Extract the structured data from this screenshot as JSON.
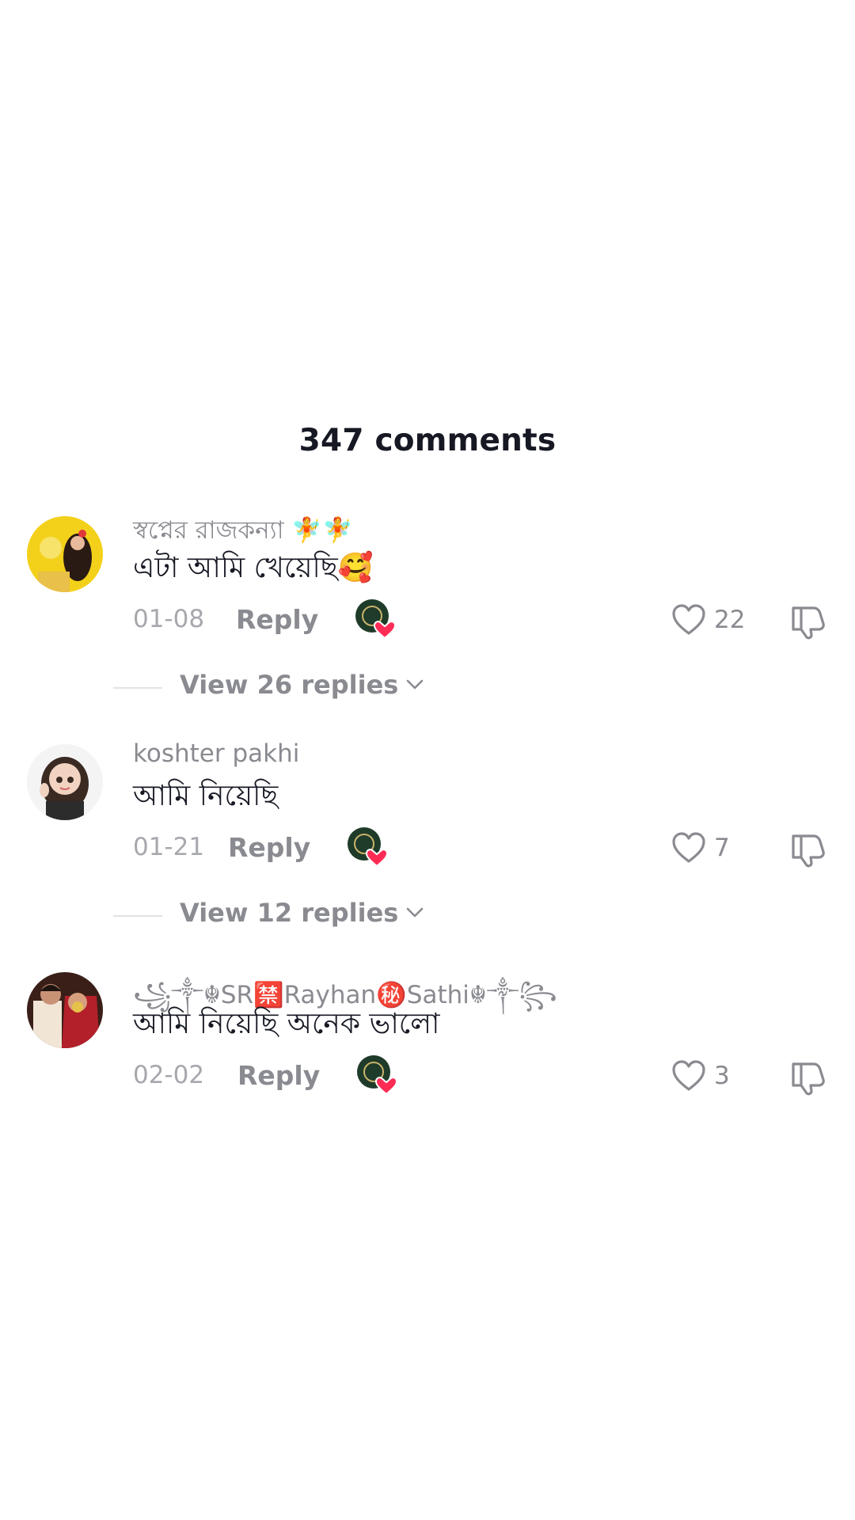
{
  "header": {
    "title": "347 comments"
  },
  "comments": [
    {
      "username": "স্বপ্নের রাজকন্যা 🧚🧚",
      "text": "এটা আমি খেয়েছি🥰",
      "date": "01-08",
      "reply_label": "Reply",
      "likes": "22",
      "replies_label": "View 26 replies"
    },
    {
      "username": "koshter pakhi",
      "text": "আমি নিয়েছি",
      "date": "01-21",
      "reply_label": "Reply",
      "likes": "7",
      "replies_label": "View 12 replies"
    },
    {
      "username": "꧁༒☬SR🈲Rayhan㊙️Sathi☬༒꧂",
      "text": "আমি নিয়েছি অনেক ভালো",
      "date": "02-02",
      "reply_label": "Reply",
      "likes": "3"
    }
  ],
  "icons": {
    "like": "heart-outline-icon",
    "dislike": "thumbs-down-icon",
    "chevron": "chevron-down-icon",
    "creator_liked": "creator-liked-heart-icon"
  },
  "colors": {
    "text_primary": "#161823",
    "text_secondary": "#8a8b91",
    "heart_accent": "#fe2c55"
  }
}
